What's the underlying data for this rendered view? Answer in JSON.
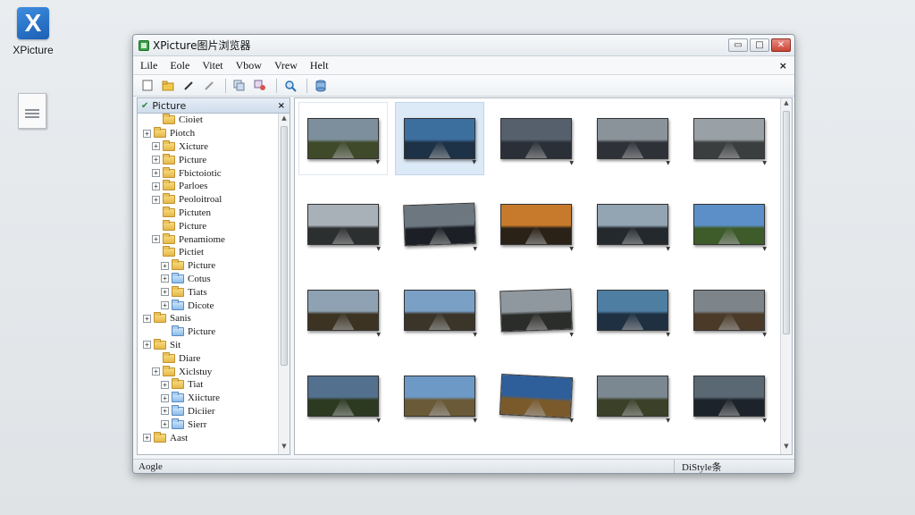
{
  "desktop": {
    "app_icon_label": "XPicture",
    "app_icon_glyph": "X"
  },
  "window": {
    "title": "XPicture图片浏览器",
    "controls": {
      "minimize": "▭",
      "maximize": "□",
      "close": "✕"
    }
  },
  "menu": {
    "items": [
      "Lile",
      "Eole",
      "Vitet",
      "Vbow",
      "Vrew",
      "Helt"
    ],
    "close_glyph": "×"
  },
  "toolbar": {
    "buttons": [
      "new-icon",
      "open-folder-icon",
      "pen-icon",
      "brush-icon",
      "copy-icon",
      "settings-icon",
      "zoom-icon",
      "database-icon"
    ]
  },
  "tree": {
    "header": "Picture",
    "close_glyph": "×",
    "items": [
      {
        "label": "Cioiet",
        "indent": 1,
        "exp": "",
        "color": "yellow"
      },
      {
        "label": "Piotch",
        "indent": 0,
        "exp": "+",
        "color": "yellow"
      },
      {
        "label": "Xicture",
        "indent": 1,
        "exp": "+",
        "color": "yellow"
      },
      {
        "label": "Picture",
        "indent": 1,
        "exp": "+",
        "color": "yellow"
      },
      {
        "label": "Fbictoiotic",
        "indent": 1,
        "exp": "+",
        "color": "yellow"
      },
      {
        "label": "Parloes",
        "indent": 1,
        "exp": "+",
        "color": "yellow"
      },
      {
        "label": "Peoloitroal",
        "indent": 1,
        "exp": "+",
        "color": "yellow"
      },
      {
        "label": "Pictuten",
        "indent": 1,
        "exp": "",
        "color": "yellow"
      },
      {
        "label": "Picture",
        "indent": 1,
        "exp": "",
        "color": "yellow"
      },
      {
        "label": "Penamiome",
        "indent": 1,
        "exp": "+",
        "color": "yellow"
      },
      {
        "label": "Pictiet",
        "indent": 1,
        "exp": "",
        "color": "yellow"
      },
      {
        "label": "Picture",
        "indent": 2,
        "exp": "+",
        "color": "yellow"
      },
      {
        "label": "Cotus",
        "indent": 2,
        "exp": "+",
        "color": "blue"
      },
      {
        "label": "Tiats",
        "indent": 2,
        "exp": "+",
        "color": "yellow"
      },
      {
        "label": "Dicote",
        "indent": 2,
        "exp": "+",
        "color": "blue"
      },
      {
        "label": "Sanis",
        "indent": 0,
        "exp": "+",
        "color": "yellow"
      },
      {
        "label": "Picture",
        "indent": 2,
        "exp": "",
        "color": "blue"
      },
      {
        "label": "Sit",
        "indent": 0,
        "exp": "+",
        "color": "yellow"
      },
      {
        "label": "Diare",
        "indent": 1,
        "exp": "",
        "color": "yellow"
      },
      {
        "label": "Xiclstuy",
        "indent": 1,
        "exp": "+",
        "color": "yellow"
      },
      {
        "label": "Tiat",
        "indent": 2,
        "exp": "+",
        "color": "yellow"
      },
      {
        "label": "Xiicture",
        "indent": 2,
        "exp": "+",
        "color": "blue"
      },
      {
        "label": "Diciier",
        "indent": 2,
        "exp": "+",
        "color": "blue"
      },
      {
        "label": "Sierr",
        "indent": 2,
        "exp": "+",
        "color": "blue"
      },
      {
        "label": "Aast",
        "indent": 0,
        "exp": "+",
        "color": "yellow"
      }
    ]
  },
  "thumbnails": [
    {
      "sky": "#7d8f9c",
      "land": "#3f4a2a",
      "variant": "",
      "state": "first"
    },
    {
      "sky": "#3c6e9e",
      "land": "#1d3147",
      "variant": "",
      "state": "selected"
    },
    {
      "sky": "#55606c",
      "land": "#2a2f38",
      "variant": "",
      "state": ""
    },
    {
      "sky": "#8b939a",
      "land": "#2e3238",
      "variant": "",
      "state": ""
    },
    {
      "sky": "#9aa1a6",
      "land": "#3a3e3f",
      "variant": "",
      "state": ""
    },
    {
      "sky": "#a9b1b8",
      "land": "#2c2f30",
      "variant": "",
      "state": ""
    },
    {
      "sky": "#6d7780",
      "land": "#1c2026",
      "variant": "tilt",
      "state": ""
    },
    {
      "sky": "#c77a2b",
      "land": "#2a2117",
      "variant": "",
      "state": ""
    },
    {
      "sky": "#93a4b3",
      "land": "#24292e",
      "variant": "",
      "state": ""
    },
    {
      "sky": "#5c8fc7",
      "land": "#3e5b2a",
      "variant": "",
      "state": ""
    },
    {
      "sky": "#8ea2b3",
      "land": "#3c3322",
      "variant": "",
      "state": ""
    },
    {
      "sky": "#7aa0c6",
      "land": "#3b3529",
      "variant": "",
      "state": ""
    },
    {
      "sky": "#8f989e",
      "land": "#2b2d2a",
      "variant": "tilt",
      "state": ""
    },
    {
      "sky": "#4f7ea3",
      "land": "#1e3042",
      "variant": "",
      "state": ""
    },
    {
      "sky": "#7d858b",
      "land": "#4a3a27",
      "variant": "",
      "state": ""
    },
    {
      "sky": "#53718e",
      "land": "#2d3a22",
      "variant": "",
      "state": ""
    },
    {
      "sky": "#6d99c7",
      "land": "#6b5a37",
      "variant": "",
      "state": ""
    },
    {
      "sky": "#2f5f9a",
      "land": "#7a5a2b",
      "variant": "tilt2",
      "state": ""
    },
    {
      "sky": "#7b8791",
      "land": "#3b4128",
      "variant": "",
      "state": ""
    },
    {
      "sky": "#5a6874",
      "land": "#1c232b",
      "variant": "",
      "state": ""
    }
  ],
  "status": {
    "left": "Aogle",
    "right": "DiStyle条"
  }
}
